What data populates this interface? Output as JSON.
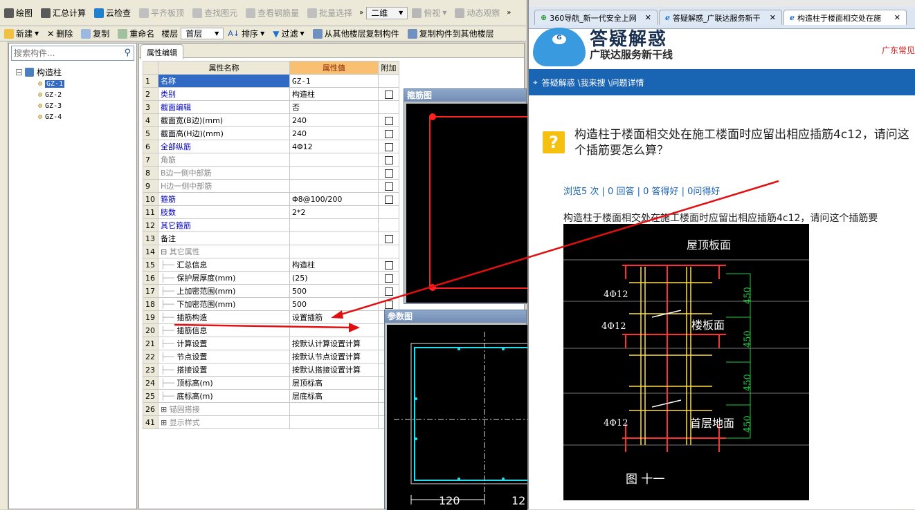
{
  "app": {
    "menu": [
      {
        "label": "绘图",
        "icon": "draw-icon"
      },
      {
        "label": "汇总计算",
        "icon": "sigma-icon"
      },
      {
        "label": "云检查",
        "icon": "cloud-check-icon"
      },
      {
        "label": "平齐板顶",
        "icon": "align-top-icon"
      },
      {
        "label": "查找图元",
        "icon": "find-icon"
      },
      {
        "label": "查看钢筋量",
        "icon": "view-rebar-icon"
      },
      {
        "label": "批量选择",
        "icon": "batch-select-icon"
      }
    ],
    "view_select": "二维",
    "view_label": "俯视",
    "dynamic_label": "动态观察",
    "toolbar2": {
      "new": "新建",
      "delete": "删除",
      "copy": "复制",
      "rename": "重命名",
      "floor_label": "楼层",
      "floor_value": "首层",
      "sort": "排序",
      "filter": "过滤",
      "copy_from": "从其他楼层复制构件",
      "copy_to": "复制构件到其他楼层"
    },
    "search_placeholder": "搜索构件...",
    "tree": {
      "root": "构造柱",
      "items": [
        "GZ-1",
        "GZ-2",
        "GZ-3",
        "GZ-4"
      ]
    },
    "tab_label": "属性编辑",
    "grid_headers": [
      "属性名称",
      "属性值",
      "附加"
    ],
    "rows": [
      {
        "n": "1",
        "name": "名称",
        "val": "GZ-1",
        "cb": false,
        "style": "sel"
      },
      {
        "n": "2",
        "name": "类别",
        "val": "构造柱",
        "cb": true,
        "style": "blue"
      },
      {
        "n": "3",
        "name": "截面编辑",
        "val": "否",
        "cb": false,
        "style": "blue"
      },
      {
        "n": "4",
        "name": "截面宽(B边)(mm)",
        "val": "240",
        "cb": true,
        "style": ""
      },
      {
        "n": "5",
        "name": "截面高(H边)(mm)",
        "val": "240",
        "cb": true,
        "style": ""
      },
      {
        "n": "6",
        "name": "全部纵筋",
        "val": "4Φ12",
        "cb": true,
        "style": "blue"
      },
      {
        "n": "7",
        "name": "角筋",
        "val": "",
        "cb": true,
        "style": "gray"
      },
      {
        "n": "8",
        "name": "B边一侧中部筋",
        "val": "",
        "cb": true,
        "style": "gray"
      },
      {
        "n": "9",
        "name": "H边一侧中部筋",
        "val": "",
        "cb": true,
        "style": "gray"
      },
      {
        "n": "10",
        "name": "箍筋",
        "val": "Φ8@100/200",
        "cb": true,
        "style": "blue"
      },
      {
        "n": "11",
        "name": "肢数",
        "val": "2*2",
        "cb": false,
        "style": "blue"
      },
      {
        "n": "12",
        "name": "其它箍筋",
        "val": "",
        "cb": false,
        "style": "blue"
      },
      {
        "n": "13",
        "name": "备注",
        "val": "",
        "cb": true,
        "style": ""
      },
      {
        "n": "14",
        "name": "其它属性",
        "val": "",
        "cb": false,
        "style": "group"
      },
      {
        "n": "15",
        "name": "汇总信息",
        "val": "构造柱",
        "cb": true,
        "style": "child"
      },
      {
        "n": "16",
        "name": "保护层厚度(mm)",
        "val": "(25)",
        "cb": true,
        "style": "child"
      },
      {
        "n": "17",
        "name": "上加密范围(mm)",
        "val": "500",
        "cb": true,
        "style": "child"
      },
      {
        "n": "18",
        "name": "下加密范围(mm)",
        "val": "500",
        "cb": true,
        "style": "child"
      },
      {
        "n": "19",
        "name": "插筋构造",
        "val": "设置插筋",
        "cb": false,
        "style": "child"
      },
      {
        "n": "20",
        "name": "插筋信息",
        "val": "",
        "cb": false,
        "style": "child"
      },
      {
        "n": "21",
        "name": "计算设置",
        "val": "按默认计算设置计算",
        "cb": false,
        "style": "child"
      },
      {
        "n": "22",
        "name": "节点设置",
        "val": "按默认节点设置计算",
        "cb": false,
        "style": "child"
      },
      {
        "n": "23",
        "name": "搭接设置",
        "val": "按默认搭接设置计算",
        "cb": false,
        "style": "child"
      },
      {
        "n": "24",
        "name": "顶标高(m)",
        "val": "层顶标高",
        "cb": false,
        "style": "child"
      },
      {
        "n": "25",
        "name": "底标高(m)",
        "val": "层底标高",
        "cb": false,
        "style": "child"
      },
      {
        "n": "26",
        "name": "锚固搭接",
        "val": "",
        "cb": false,
        "style": "group"
      },
      {
        "n": "41",
        "name": "显示样式",
        "val": "",
        "cb": false,
        "style": "group"
      }
    ],
    "stirrup_title": "箍筋图",
    "param_title": "参数图",
    "param_dims": [
      "120",
      "12"
    ]
  },
  "browser": {
    "tabs": [
      {
        "label": "360导航_新一代安全上网",
        "icon": "plus-globe-icon"
      },
      {
        "label": "答疑解惑_广联达服务新干",
        "icon": "ie-icon"
      },
      {
        "label": "构造柱于楼面相交处在施",
        "icon": "ie-icon"
      }
    ],
    "logo_text": "答疑解惑",
    "logo_sub": "广联达服务新干线",
    "region": "广东常见",
    "breadcrumb": "答疑解惑 \\我来搜 \\问题详情",
    "question_title": "构造柱于楼面相交处在施工楼面时应留出相应插筋4c12，请问这个插筋要怎么算？",
    "stats": "浏览5 次 | 0 回答 | 0 答得好 | 0问得好",
    "question_body": "构造柱于楼面相交处在施工楼面时应留出相应插筋4c12，请问这个插筋要",
    "drawing_labels": {
      "roof": "屋顶板面",
      "floor": "楼板面",
      "ground": "首层地面",
      "rebar": "4Φ12",
      "dim": "450",
      "fig": "图 十一"
    }
  }
}
